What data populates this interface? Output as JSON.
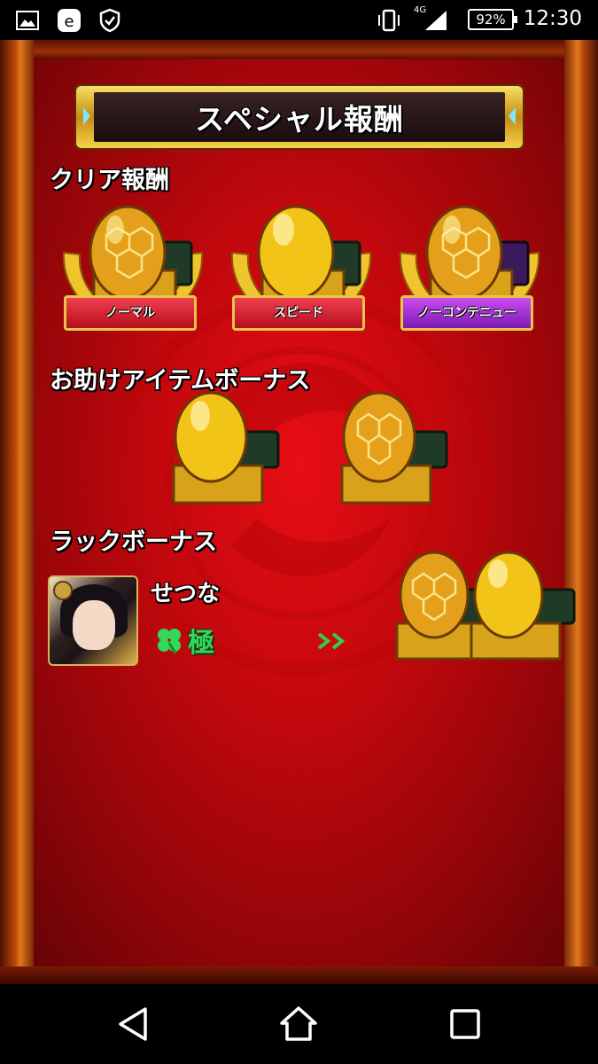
{
  "status_bar": {
    "time": "12:30",
    "battery": "92%",
    "network": "4G",
    "icons": [
      "image-icon",
      "browser-icon",
      "shield-icon",
      "vibrate-icon",
      "signal-icon",
      "battery-icon"
    ]
  },
  "screen": {
    "title": "スペシャル報酬",
    "clear_rewards": {
      "label": "クリア報酬",
      "items": [
        {
          "ribbon": "ノーマル",
          "egg": "honeycomb-gold-egg",
          "ribbon_color": "#c8101e"
        },
        {
          "ribbon": "スピード",
          "egg": "gold-egg",
          "ribbon_color": "#c8101e"
        },
        {
          "ribbon": "ノーコンテニュー",
          "egg": "honeycomb-gold-egg",
          "ribbon_color": "#8a1fc0"
        }
      ]
    },
    "item_bonus": {
      "label": "お助けアイテムボーナス",
      "items": [
        {
          "egg": "gold-egg"
        },
        {
          "egg": "honeycomb-gold-egg"
        }
      ]
    },
    "luck_bonus": {
      "label": "ラックボーナス",
      "character_name": "せつな",
      "luck_rank": "極",
      "clover_icon": "clover-icon",
      "arrow_icon": "double-arrow-icon",
      "rewards": [
        {
          "egg": "honeycomb-gold-egg"
        },
        {
          "egg": "gold-egg"
        }
      ]
    }
  },
  "nav_bar": {
    "buttons": [
      "back-button",
      "home-button",
      "recents-button"
    ]
  },
  "colors": {
    "background": "#c1080d",
    "frame": "#b9480c",
    "title_border": "#e8c44a",
    "luck_green": "#33d85a"
  }
}
